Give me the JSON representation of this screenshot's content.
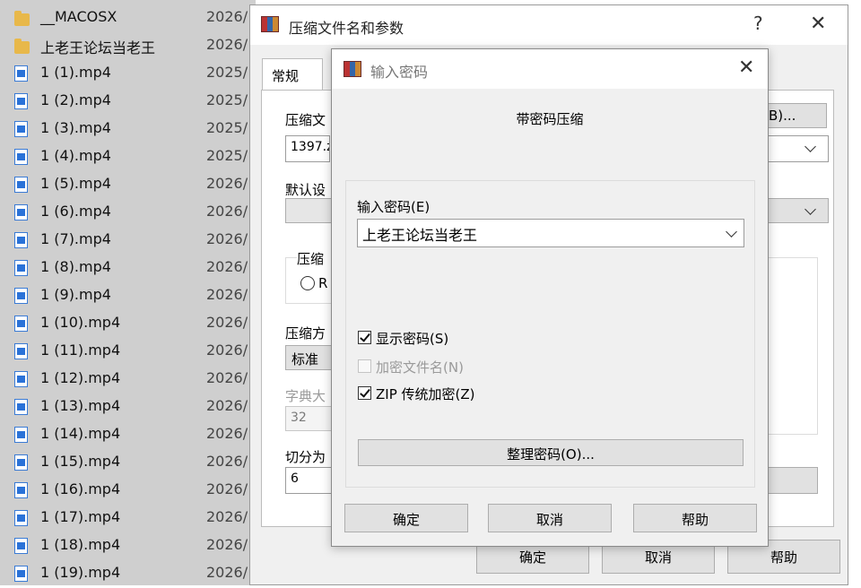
{
  "file_list": {
    "rows": [
      {
        "name": "__MACOSX",
        "date": "2026/",
        "icon": "folder-icon"
      },
      {
        "name": "上老王论坛当老王",
        "date": "2026/",
        "icon": "folder-icon"
      },
      {
        "name": "1 (1).mp4",
        "date": "2025/",
        "icon": "video-file-icon"
      },
      {
        "name": "1 (2).mp4",
        "date": "2025/",
        "icon": "video-file-icon"
      },
      {
        "name": "1 (3).mp4",
        "date": "2025/",
        "icon": "video-file-icon"
      },
      {
        "name": "1 (4).mp4",
        "date": "2025/",
        "icon": "video-file-icon"
      },
      {
        "name": "1 (5).mp4",
        "date": "2026/",
        "icon": "video-file-icon"
      },
      {
        "name": "1 (6).mp4",
        "date": "2026/",
        "icon": "video-file-icon"
      },
      {
        "name": "1 (7).mp4",
        "date": "2026/",
        "icon": "video-file-icon"
      },
      {
        "name": "1 (8).mp4",
        "date": "2026/",
        "icon": "video-file-icon"
      },
      {
        "name": "1 (9).mp4",
        "date": "2026/",
        "icon": "video-file-icon"
      },
      {
        "name": "1 (10).mp4",
        "date": "2026/",
        "icon": "video-file-icon"
      },
      {
        "name": "1 (11).mp4",
        "date": "2026/",
        "icon": "video-file-icon"
      },
      {
        "name": "1 (12).mp4",
        "date": "2026/",
        "icon": "video-file-icon"
      },
      {
        "name": "1 (13).mp4",
        "date": "2026/",
        "icon": "video-file-icon"
      },
      {
        "name": "1 (14).mp4",
        "date": "2026/",
        "icon": "video-file-icon"
      },
      {
        "name": "1 (15).mp4",
        "date": "2026/",
        "icon": "video-file-icon"
      },
      {
        "name": "1 (16).mp4",
        "date": "2026/",
        "icon": "video-file-icon"
      },
      {
        "name": "1 (17).mp4",
        "date": "2026/",
        "icon": "video-file-icon"
      },
      {
        "name": "1 (18).mp4",
        "date": "2026/",
        "icon": "video-file-icon"
      },
      {
        "name": "1 (19).mp4",
        "date": "2026/",
        "icon": "video-file-icon"
      }
    ]
  },
  "archive_dialog": {
    "title": "压缩文件名和参数",
    "help_glyph": "?",
    "close_glyph": "✕",
    "tab_general": "常规",
    "archive_name_label": "压缩文",
    "archive_name_value": "1397.z",
    "browse_button": "B)...",
    "default_settings_label": "默认设",
    "format_group_label": "压缩",
    "format_radio_label": "R",
    "method_label": "压缩方",
    "method_value": "标准",
    "dictionary_label": "字典大",
    "dictionary_value": "32",
    "split_label": "切分为",
    "split_value": "6",
    "ok_button": "确定",
    "cancel_button": "取消",
    "help_button": "帮助"
  },
  "password_dialog": {
    "title": "输入密码",
    "close_glyph": "✕",
    "heading": "带密码压缩",
    "password_label": "输入密码(E)",
    "password_value": "上老王论坛当老王",
    "show_password_label": "显示密码(S)",
    "show_password_checked": true,
    "encrypt_filenames_label": "加密文件名(N)",
    "encrypt_filenames_checked": false,
    "encrypt_filenames_enabled": false,
    "zip_legacy_label": "ZIP 传统加密(Z)",
    "zip_legacy_checked": true,
    "organize_button": "整理密码(O)...",
    "ok_button": "确定",
    "cancel_button": "取消",
    "help_button": "帮助"
  }
}
